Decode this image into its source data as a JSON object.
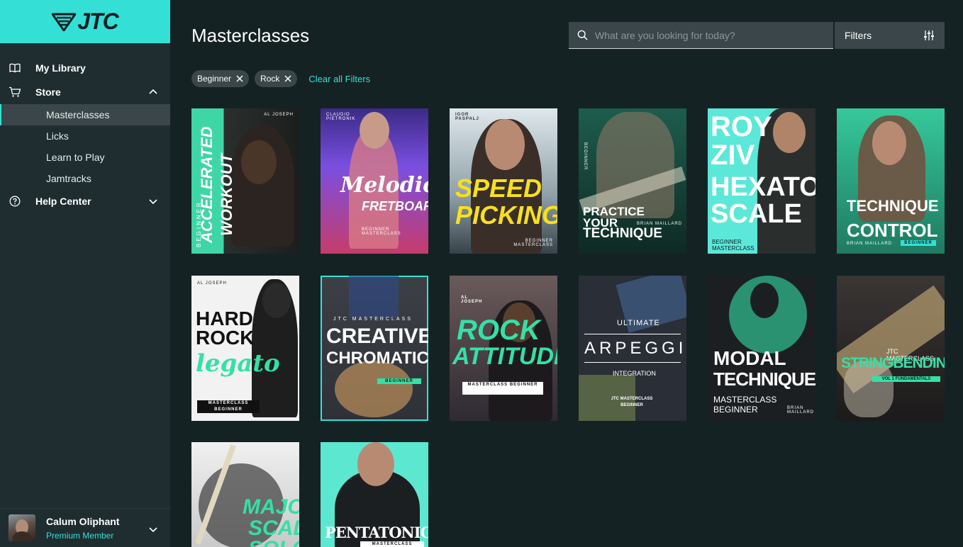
{
  "brand": {
    "logo_text": "JTC"
  },
  "sidebar": {
    "items": [
      {
        "label": "My Library",
        "icon": "book-icon"
      },
      {
        "label": "Store",
        "icon": "cart-icon"
      },
      {
        "label": "Help Center",
        "icon": "help-circle-icon"
      }
    ],
    "store_sub": [
      "Masterclasses",
      "Licks",
      "Learn to Play",
      "Jamtracks"
    ],
    "active_sub": "Masterclasses"
  },
  "user": {
    "name": "Calum Oliphant",
    "role": "Premium Member"
  },
  "header": {
    "title": "Masterclasses",
    "search_placeholder": "What are you looking for today?",
    "filters_label": "Filters"
  },
  "chips": [
    "Beginner",
    "Rock"
  ],
  "clear_filters": "Clear all Filters",
  "cards": [
    {
      "l1": "ACCELERATED",
      "l2": "WORKOUT",
      "tag": "BEGINNER",
      "artist": "AL JOSEPH",
      "bg": "#3fd6a6"
    },
    {
      "l1": "Melodic",
      "l2": "FRETBOARD",
      "tag": "BEGINNER MASTERCLASS",
      "artist": "CLAUDIO PIETRONIK",
      "bg": "#6a4fd0"
    },
    {
      "l1": "SPEED",
      "l2": "PICKING",
      "tag": "BEGINNER MASTERCLASS",
      "artist": "IGOR PASPALJ",
      "bg": "#5e6e78"
    },
    {
      "l1": "PRACTICE YOUR",
      "l2": "TECHNIQUE",
      "tag": "BEGINNER",
      "artist": "BRIAN MAILLARD",
      "bg": "#1e4a40"
    },
    {
      "l1": "ROY ZIV",
      "l2": "HEXATONIC SCALE",
      "tag": "BEGINNER MASTERCLASS",
      "artist": "",
      "bg": "#5ce8d8"
    },
    {
      "l1": "TECHNIQUE",
      "l2": "CONTROL",
      "tag": "BEGINNER",
      "artist": "BRIAN MAILLARD",
      "bg": "#2fb890"
    },
    {
      "l1": "HARD ROCK",
      "l2": "legato",
      "tag": "MASTERCLASS BEGINNER",
      "artist": "AL JOSEPH",
      "bg": "#f2f2f2"
    },
    {
      "l1": "CREATIVE",
      "l2": "CHROMATICS",
      "tag": "BEGINNER",
      "artist": "JTC MASTERCLASS",
      "bg": "#3a3e44"
    },
    {
      "l1": "ROCK",
      "l2": "ATTITUDE",
      "tag": "MASTERCLASS BEGINNER",
      "artist": "AL JOSEPH",
      "bg": "#4a3a44"
    },
    {
      "l1": "ULTIMATE",
      "l2": "ARPEGGIO",
      "tag": "JTC MASTERCLASS BEGINNER",
      "artist": "INTEGRATION",
      "bg": "#2a2e36"
    },
    {
      "l1": "MODAL",
      "l2": "TECHNIQUES",
      "tag": "MASTERCLASS BEGINNER",
      "artist": "BRIAN MAILLARD",
      "bg": "#1c1f22"
    },
    {
      "l1": "STRINGBENDING",
      "l2": "VOL 1 FUNDAMENTALS",
      "tag": "",
      "artist": "JTC MASTERCLASS",
      "bg": "#2a2a2a"
    },
    {
      "l1": "MAJOR",
      "l2": "SCALE SOLOING",
      "tag": "",
      "artist": "",
      "bg": "#e6e6e6"
    },
    {
      "l1": "PENTATONICS",
      "l2": "MASTERCLASS",
      "tag": "",
      "artist": "",
      "bg": "#5ce8d0"
    }
  ]
}
